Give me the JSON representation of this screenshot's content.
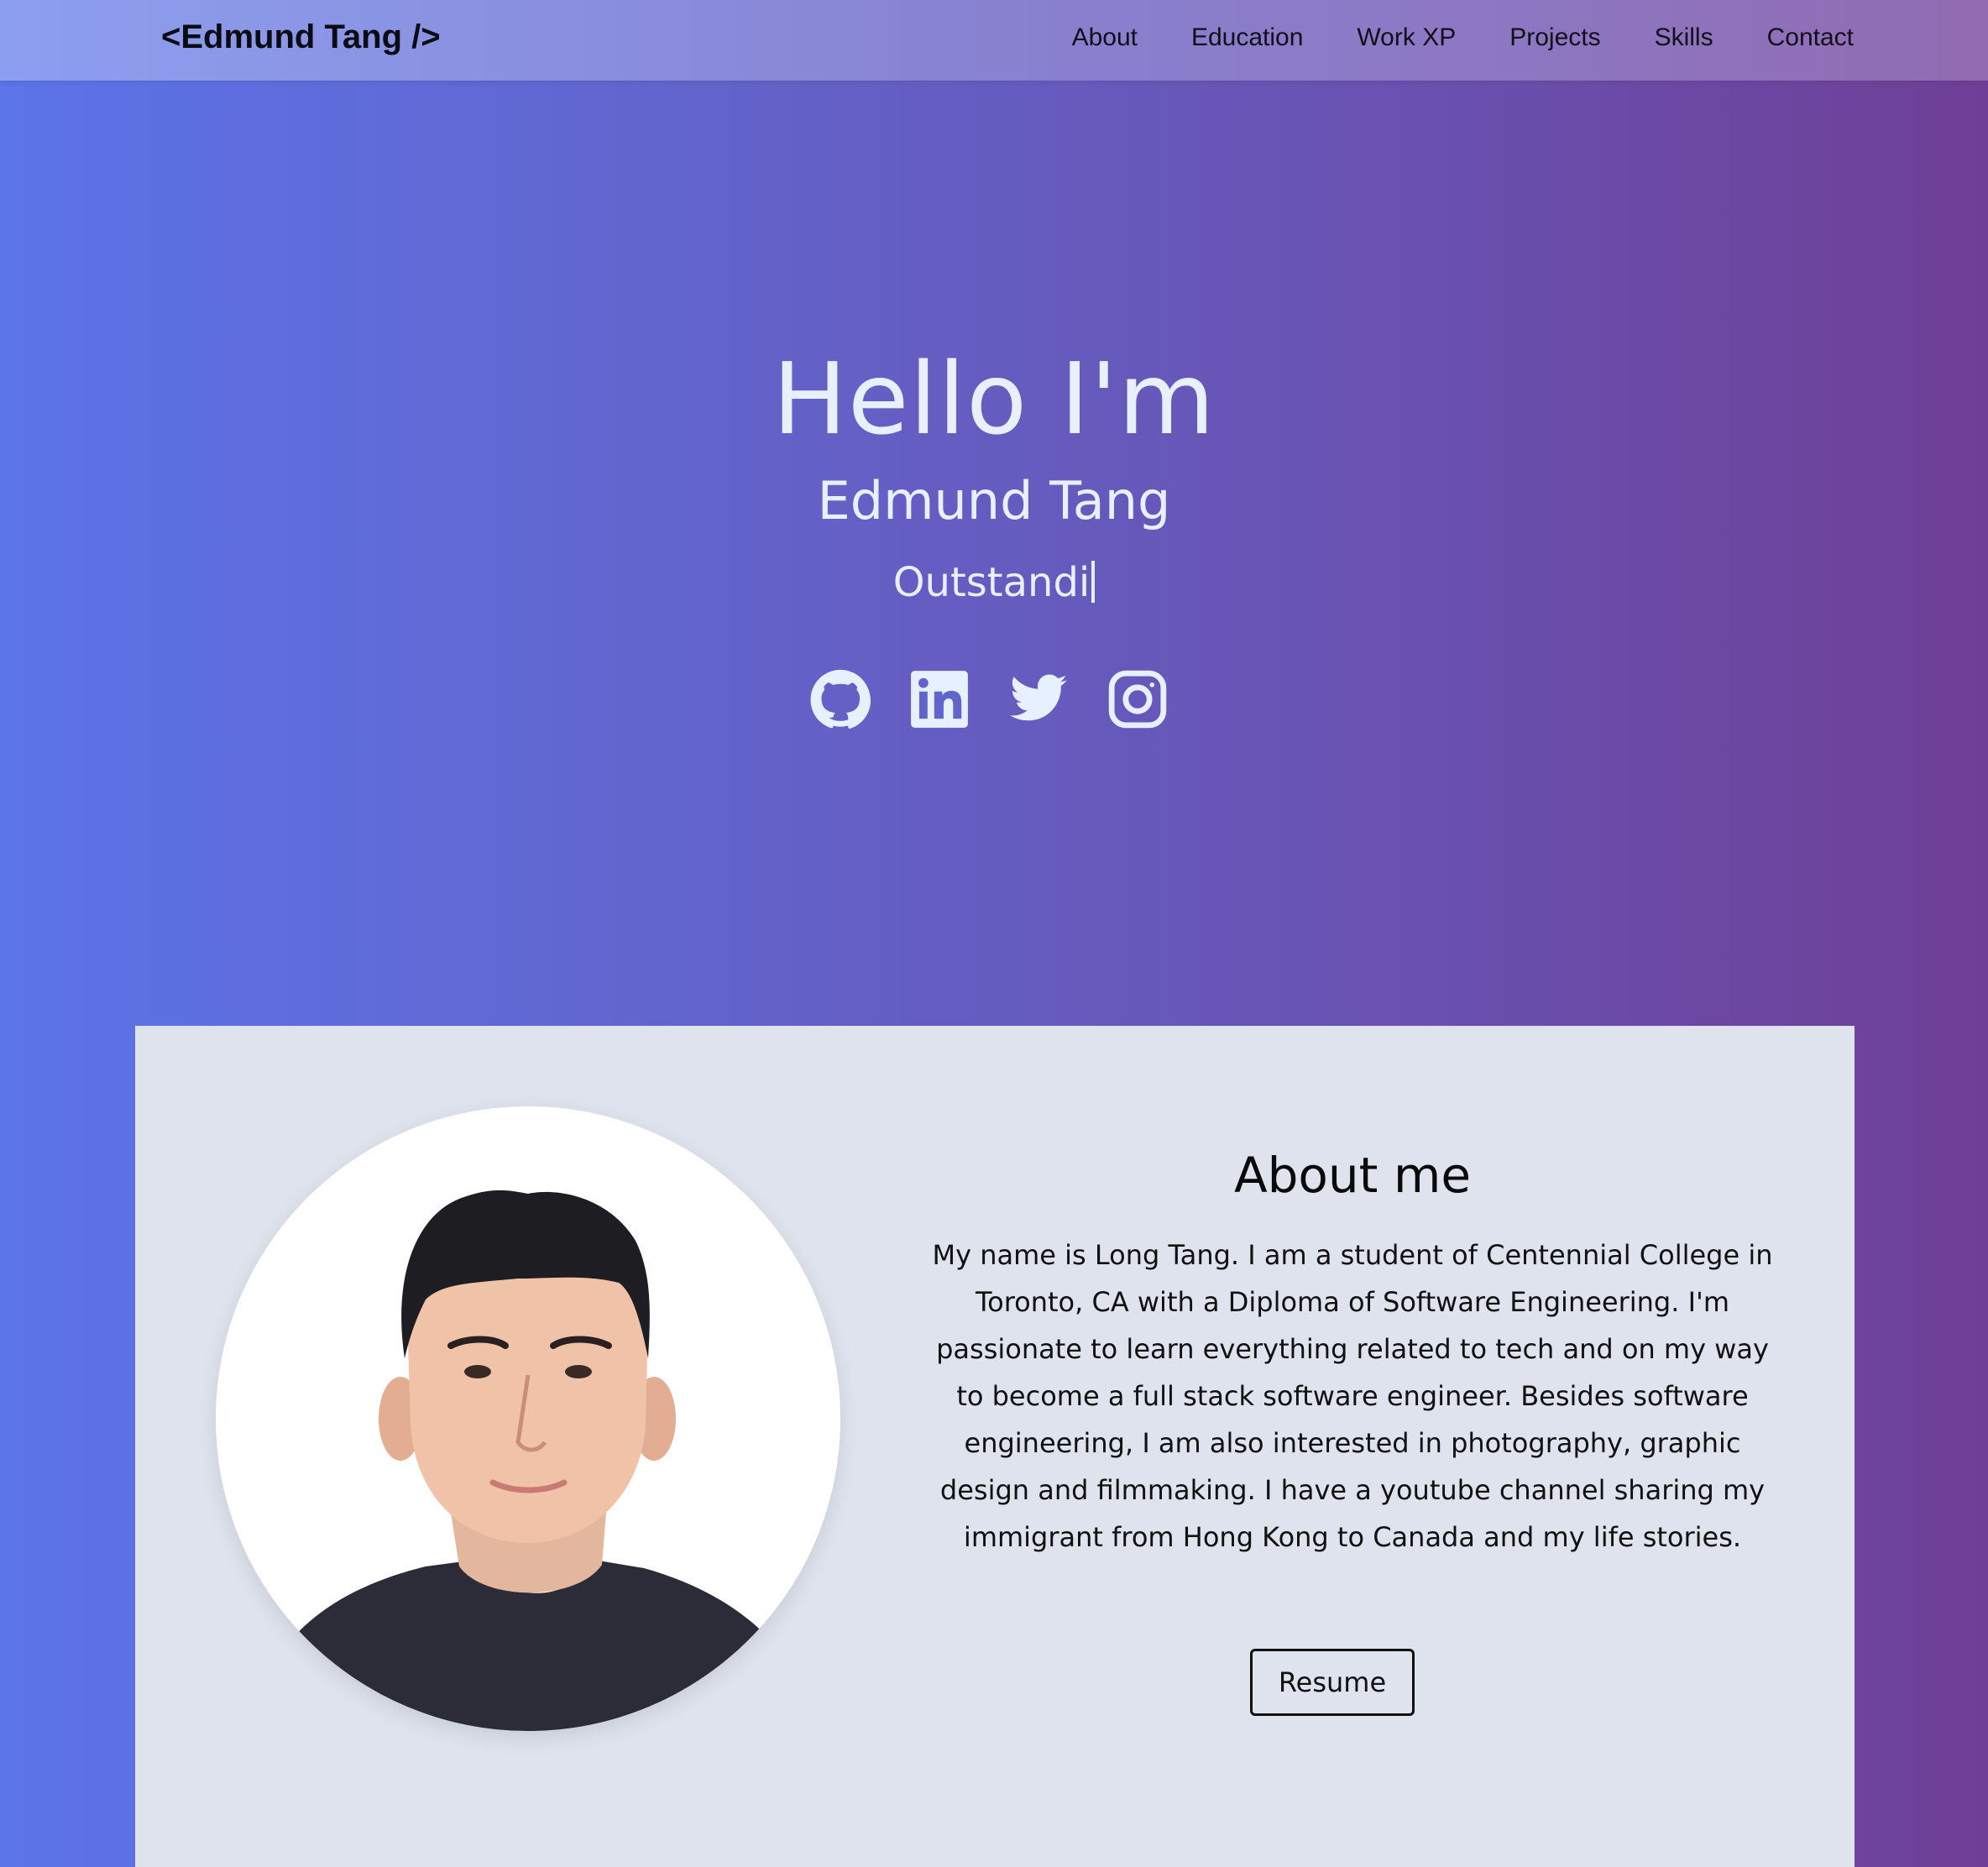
{
  "navbar": {
    "brand": "<Edmund Tang />",
    "links": [
      "About",
      "Education",
      "Work XP",
      "Projects",
      "Skills",
      "Contact"
    ]
  },
  "hero": {
    "greeting": "Hello I'm",
    "name": "Edmund Tang",
    "typed_text": "Outstandi",
    "socials": [
      "github-icon",
      "linkedin-icon",
      "twitter-icon",
      "instagram-icon"
    ]
  },
  "about": {
    "title": "About me",
    "body": "My name is Long Tang. I am a student of Centennial College in Toronto, CA with a Diploma of Software Engineering. I'm passionate to learn everything related to tech and on my way to become a full stack software engineer. Besides software engineering, I am also interested in photography, graphic design and filmmaking. I have a youtube channel sharing my immigrant from Hong Kong to Canada and my life stories.",
    "resume_label": "Resume"
  },
  "colors": {
    "gradient_start": "#5b74e8",
    "gradient_end": "#6e3f96",
    "hero_text": "#e6f0ff",
    "card_bg": "#dee3ee"
  }
}
